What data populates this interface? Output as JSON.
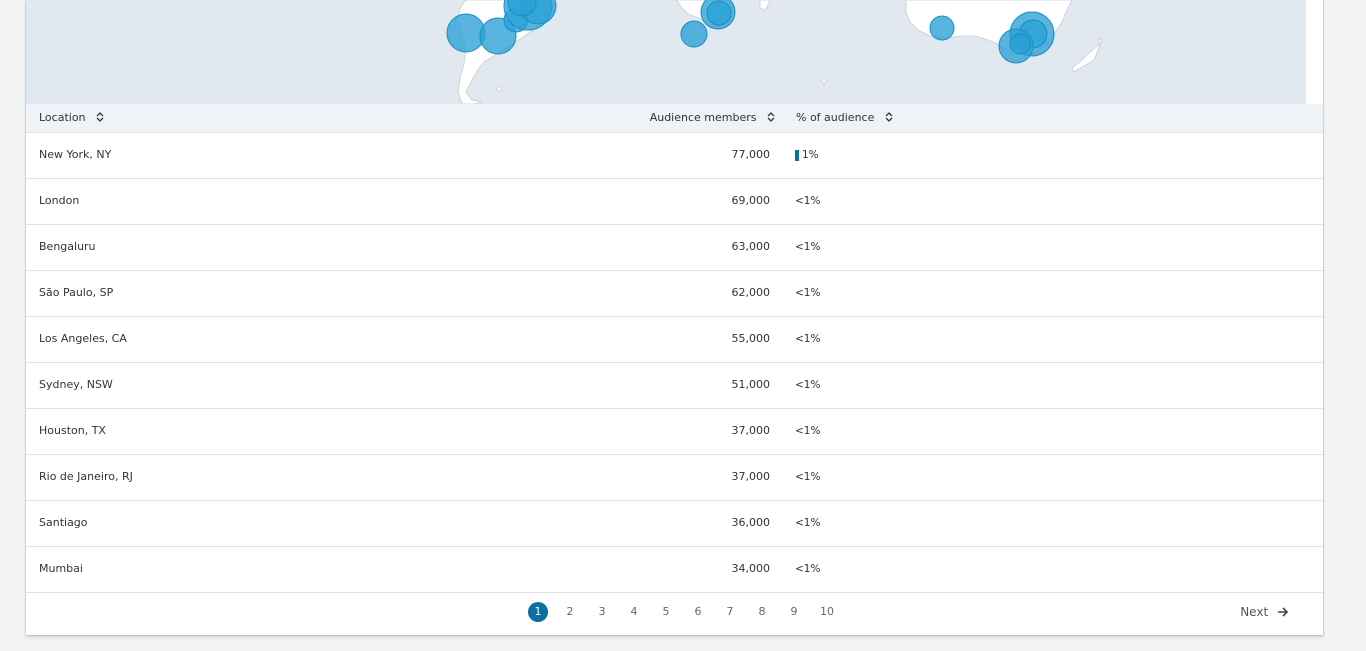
{
  "table": {
    "headers": {
      "location": "Location",
      "members": "Audience members",
      "percent": "% of audience"
    },
    "rows": [
      {
        "location": "New York, NY",
        "members": "77,000",
        "percent": "1%",
        "bar": true
      },
      {
        "location": "London",
        "members": "69,000",
        "percent": "<1%",
        "bar": false
      },
      {
        "location": "Bengaluru",
        "members": "63,000",
        "percent": "<1%",
        "bar": false
      },
      {
        "location": "São Paulo, SP",
        "members": "62,000",
        "percent": "<1%",
        "bar": false
      },
      {
        "location": "Los Angeles, CA",
        "members": "55,000",
        "percent": "<1%",
        "bar": false
      },
      {
        "location": "Sydney, NSW",
        "members": "51,000",
        "percent": "<1%",
        "bar": false
      },
      {
        "location": "Houston, TX",
        "members": "37,000",
        "percent": "<1%",
        "bar": false
      },
      {
        "location": "Rio de Janeiro, RJ",
        "members": "37,000",
        "percent": "<1%",
        "bar": false
      },
      {
        "location": "Santiago",
        "members": "36,000",
        "percent": "<1%",
        "bar": false
      },
      {
        "location": "Mumbai",
        "members": "34,000",
        "percent": "<1%",
        "bar": false
      }
    ]
  },
  "pagination": {
    "pages": [
      "1",
      "2",
      "3",
      "4",
      "5",
      "6",
      "7",
      "8",
      "9",
      "10"
    ],
    "current": "1",
    "next_label": "Next"
  },
  "colors": {
    "accent": "#0b6fa4",
    "bubble": "#2aa0d6",
    "map_water": "#e1e8ef",
    "header_bg": "#eef3f7"
  },
  "icons": {
    "sort": "sort-icon",
    "next": "arrow-right-icon"
  }
}
